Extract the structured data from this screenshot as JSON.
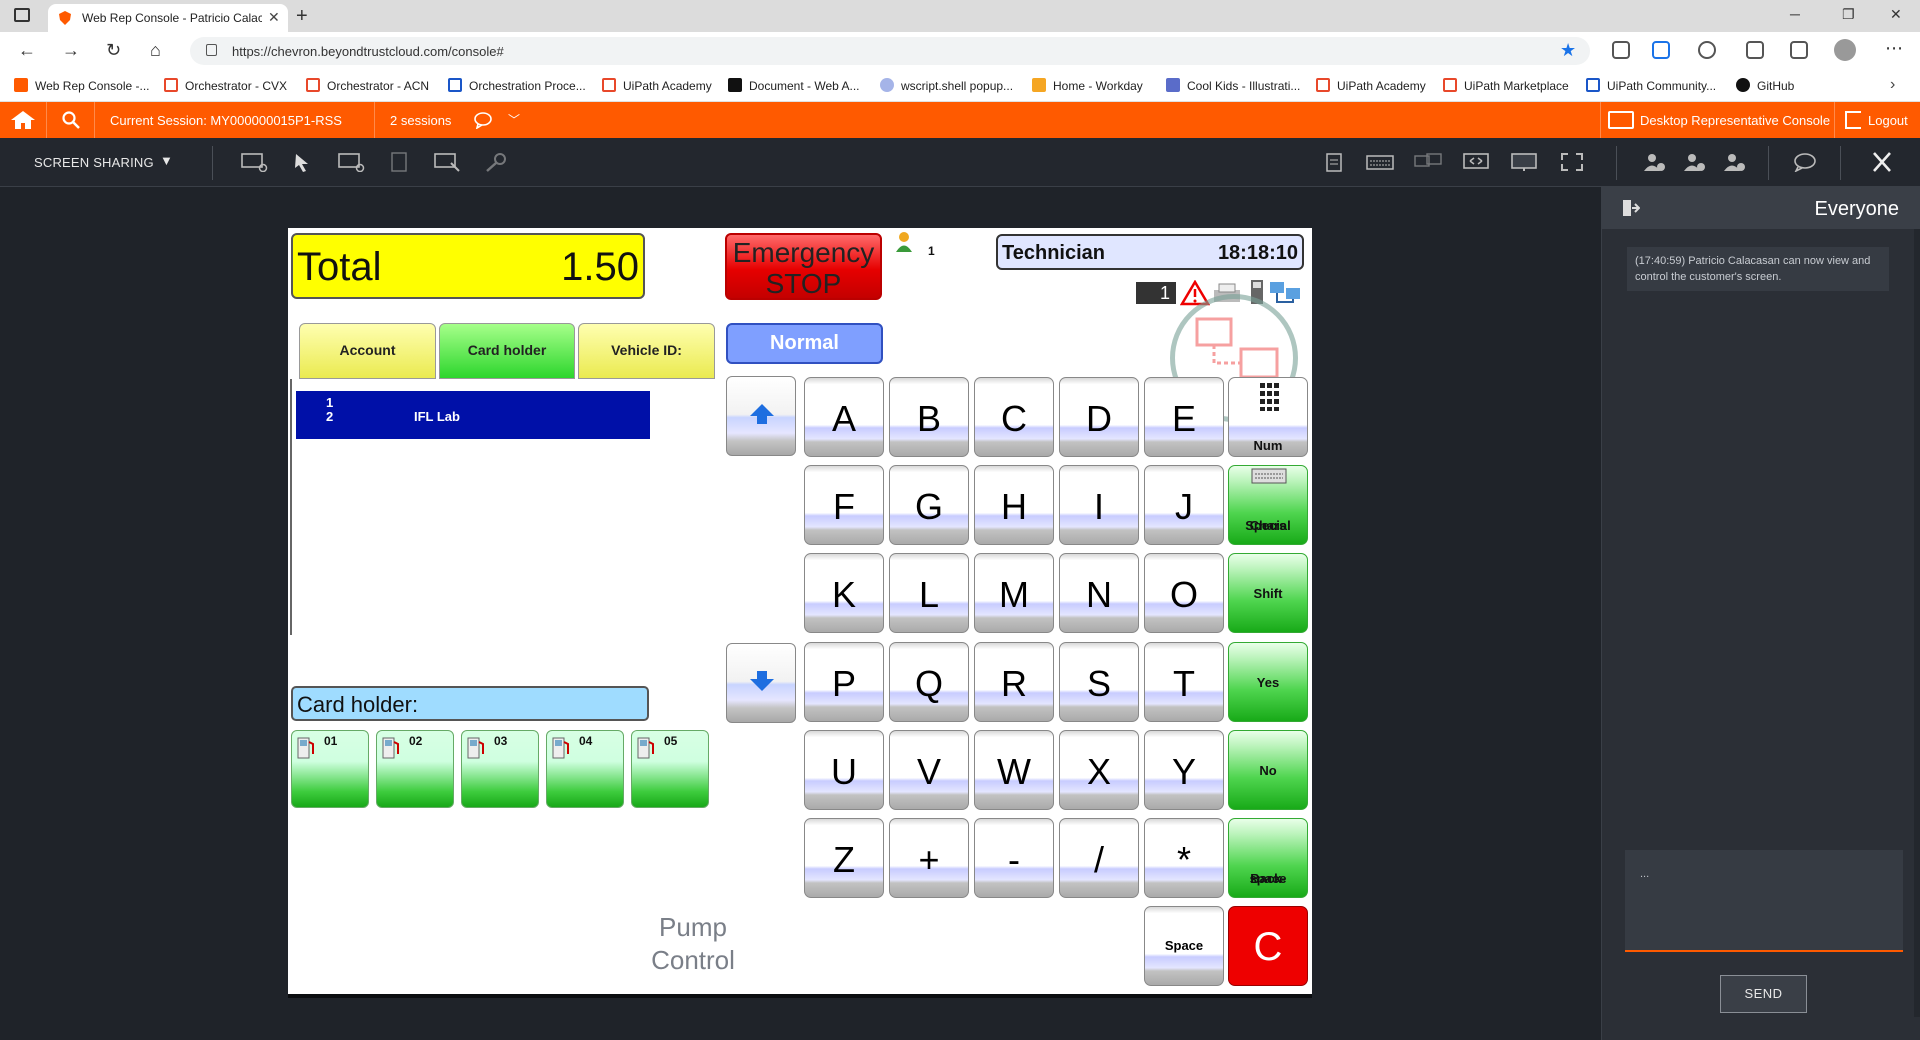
{
  "browser": {
    "tab_title": "Web Rep Console - Patricio Calac",
    "url": "https://chevron.beyondtrustcloud.com/console#",
    "bookmarks": [
      "Web Rep Console -...",
      "Orchestrator - CVX",
      "Orchestrator - ACN",
      "Orchestration Proce...",
      "UiPath Academy",
      "Document - Web A...",
      "wscript.shell popup...",
      "Home - Workday",
      "Cool Kids - Illustrati...",
      "UiPath Academy",
      "UiPath Marketplace",
      "UiPath Community...",
      "GitHub"
    ]
  },
  "session_bar": {
    "current_session": "Current Session: MY000000015P1-RSS",
    "sessions": "2 sessions",
    "desktop_console": "Desktop Representative Console",
    "logout": "Logout",
    "accent": "#ff5a00"
  },
  "toolbar": {
    "screen_sharing": "SCREEN SHARING"
  },
  "pos": {
    "total_label": "Total",
    "total_value": "1.50",
    "emergency_line1": "Emergency",
    "emergency_line2": "STOP",
    "user_count": "1",
    "role": "Technician",
    "time": "18:18:10",
    "status_badge": "1",
    "tabs": [
      "Account",
      "Card holder",
      "Vehicle ID:"
    ],
    "mode_button": "Normal",
    "list_row": {
      "line1": "1",
      "line2": "2",
      "name": "IFL Lab"
    },
    "cardholder_label": "Card holder:",
    "pumps": [
      "01",
      "02",
      "03",
      "04",
      "05"
    ],
    "pump_control_line1": "Pump",
    "pump_control_line2": "Control",
    "keys": {
      "row1": [
        "A",
        "B",
        "C",
        "D",
        "E"
      ],
      "row2": [
        "F",
        "G",
        "H",
        "I",
        "J"
      ],
      "row3": [
        "K",
        "L",
        "M",
        "N",
        "O"
      ],
      "row4": [
        "P",
        "Q",
        "R",
        "S",
        "T"
      ],
      "row5": [
        "U",
        "V",
        "W",
        "X",
        "Y"
      ],
      "row6": [
        "Z",
        "+",
        "-",
        "/",
        "*"
      ]
    },
    "func_keys": {
      "num": "Num",
      "special_line1": "Special",
      "special_line2": "Chars",
      "shift": "Shift",
      "yes": "Yes",
      "no": "No",
      "backspace_line1": "Back-",
      "backspace_line2": "space",
      "space": "Space",
      "clear": "C"
    }
  },
  "chat": {
    "header": "Everyone",
    "message": "(17:40:59) Patricio Calacasan can now view and control the customer's screen.",
    "compose_text": "...",
    "send": "SEND"
  }
}
